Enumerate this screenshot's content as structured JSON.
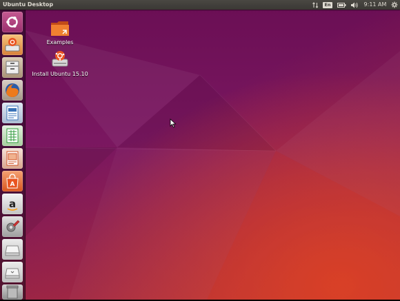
{
  "topbar": {
    "title": "Ubuntu Desktop",
    "lang": "En",
    "time": "9:11 AM"
  },
  "desktop": {
    "icons": [
      {
        "label": "Examples",
        "icon": "folder-icon"
      },
      {
        "label": "Install Ubuntu 15.10",
        "icon": "install-ubuntu-icon"
      }
    ]
  },
  "launcher": {
    "items": [
      {
        "name": "dash-home",
        "color": "#c14b8a"
      },
      {
        "name": "install-ubuntu",
        "color": "#f0a85a"
      },
      {
        "name": "files",
        "color": "#c7b299"
      },
      {
        "name": "firefox",
        "color": "#e66000"
      },
      {
        "name": "libreoffice-writer",
        "color": "#3a73b8"
      },
      {
        "name": "libreoffice-calc",
        "color": "#2e9a3a"
      },
      {
        "name": "libreoffice-impress",
        "color": "#d2562a"
      },
      {
        "name": "ubuntu-software-center",
        "color": "#e95420"
      },
      {
        "name": "amazon",
        "color": "#e6e6e6"
      },
      {
        "name": "system-settings",
        "color": "#b5b5b5"
      },
      {
        "name": "drive",
        "color": "#d9d9d9"
      },
      {
        "name": "drive-2",
        "color": "#d9d9d9"
      },
      {
        "name": "trash",
        "color": "#9a9a9a"
      }
    ]
  }
}
